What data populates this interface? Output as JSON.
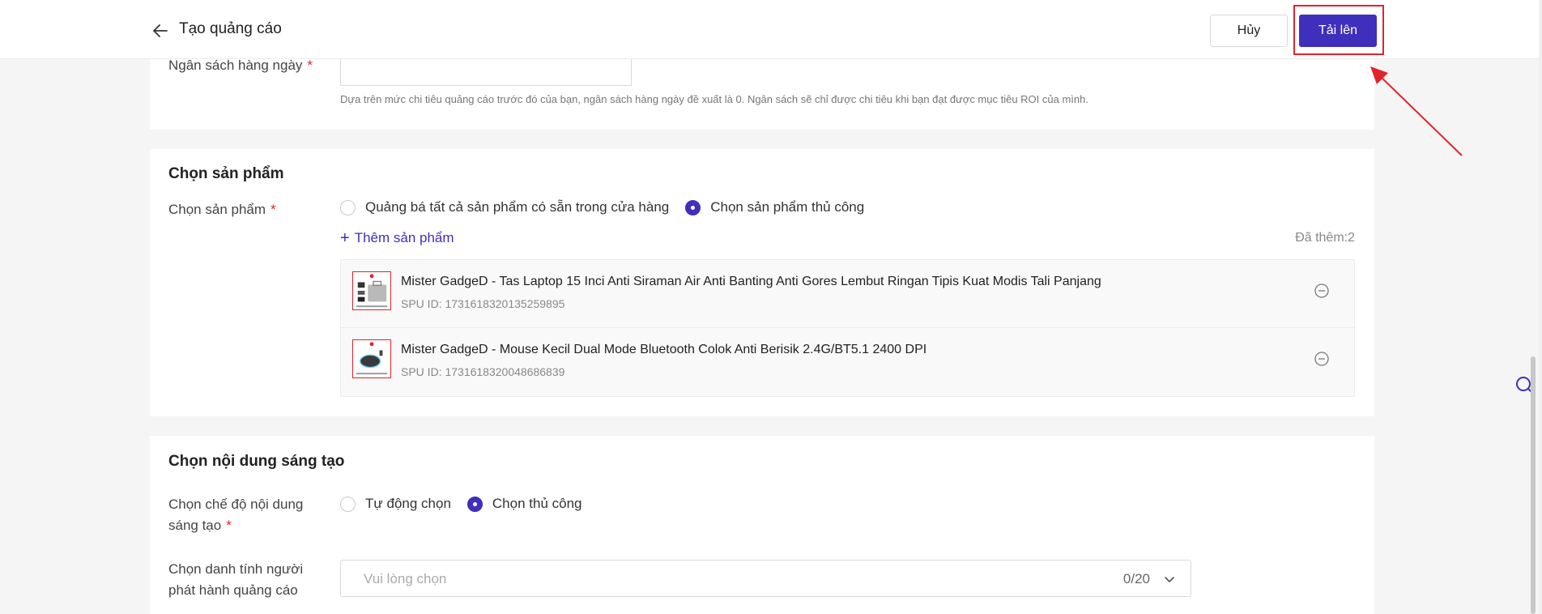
{
  "header": {
    "title": "Tạo quảng cáo",
    "cancel_label": "Hủy",
    "upload_label": "Tải lên"
  },
  "budget": {
    "label": "Ngân sách hàng ngày",
    "required_mark": "*",
    "hint": "Dựa trên mức chi tiêu quảng cáo trước đó của bạn, ngân sách hàng ngày đề xuất là 0. Ngân sách sẽ chỉ được chi tiêu khi bạn đạt được mục tiêu ROI của mình."
  },
  "products": {
    "section_title": "Chọn sản phẩm",
    "field_label": "Chọn sản phẩm",
    "required_mark": "*",
    "options": [
      {
        "label": "Quảng bá tất cả sản phẩm có sẵn trong cửa hàng",
        "checked": false
      },
      {
        "label": "Chọn sản phẩm thủ công",
        "checked": true
      }
    ],
    "add_label": "Thêm sản phẩm",
    "added_count": "Đã thêm:2",
    "items": [
      {
        "name": "Mister GadgeD - Tas Laptop 15 Inci Anti Siraman Air Anti Banting Anti Gores Lembut Ringan Tipis Kuat Modis Tali Panjang",
        "spu": "SPU ID: 1731618320135259895"
      },
      {
        "name": "Mister GadgeD - Mouse Kecil Dual Mode Bluetooth Colok Anti Berisik 2.4G/BT5.1 2400 DPI",
        "spu": "SPU ID: 1731618320048686839"
      }
    ]
  },
  "creative": {
    "section_title": "Chọn nội dung sáng tạo",
    "mode_label_line1": "Chọn chế độ nội dung",
    "mode_label_line2": "sáng tạo",
    "required_mark": "*",
    "options": [
      {
        "label": "Tự động chọn",
        "checked": false
      },
      {
        "label": "Chọn thủ công",
        "checked": true
      }
    ],
    "identity_label_line1": "Chọn danh tính người",
    "identity_label_line2": "phát hành quảng cáo",
    "identity_placeholder": "Vui lòng chọn",
    "identity_count": "0/20"
  },
  "colors": {
    "accent": "#3f2fbd",
    "highlight": "#e0242b"
  }
}
